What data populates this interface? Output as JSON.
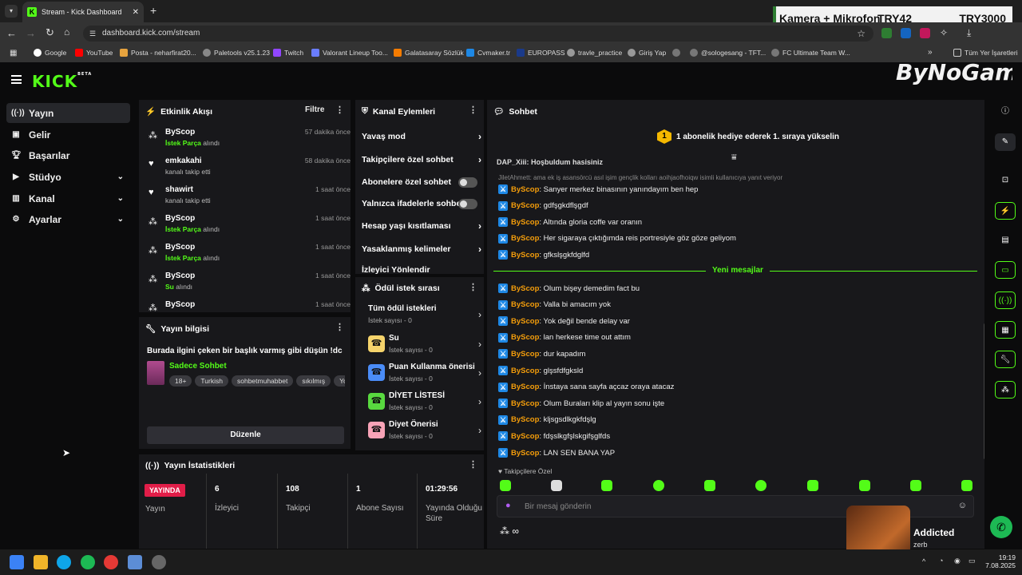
{
  "browser": {
    "tab_title": "Stream - Kick Dashboard",
    "url": "dashboard.kick.com/stream",
    "bookmarks": [
      "Google",
      "YouTube",
      "Posta - neharfirat20...",
      "Paletools v25.1.23",
      "Twitch",
      "Valorant Lineup Too...",
      "Galatasaray Sözlük",
      "Cvmaker.tr",
      "EUROPASS",
      "travle_practice",
      "Giriş Yap",
      "",
      "@sologesang - TFT...",
      "FC Ultimate Team W..."
    ],
    "all_bookmarks": "Tüm Yer İşaretleri"
  },
  "overlay": {
    "top_text": "Kamera + Mikrofon",
    "top_price1": "TRY42",
    "top_price2": "TRY3000",
    "watermark": "ByNoGame",
    "music_title": "Addicted",
    "music_artist": "zerb"
  },
  "kick": {
    "logo": "KICK",
    "logo_beta": "BETA"
  },
  "sidebar": {
    "items": [
      {
        "label": "Yayın",
        "icon": "broadcast-icon"
      },
      {
        "label": "Gelir",
        "icon": "wallet-icon"
      },
      {
        "label": "Başarılar",
        "icon": "trophy-icon"
      },
      {
        "label": "Stüdyo",
        "icon": "video-icon"
      },
      {
        "label": "Kanal",
        "icon": "bars-icon"
      },
      {
        "label": "Ayarlar",
        "icon": "gear-icon"
      }
    ]
  },
  "activity": {
    "title": "Etkinlik Akışı",
    "filter": "Filtre",
    "events": [
      {
        "name": "ByScop",
        "pre": "",
        "hl": "İstek Parça",
        "post": " alındı",
        "time": "57 dakika önce",
        "icon": "reward-icon"
      },
      {
        "name": "emkakahi",
        "pre": "kanalı takip etti",
        "hl": "",
        "post": "",
        "time": "58 dakika önce",
        "icon": "heart-icon"
      },
      {
        "name": "shawirt",
        "pre": "kanalı takip etti",
        "hl": "",
        "post": "",
        "time": "1 saat önce",
        "icon": "heart-icon"
      },
      {
        "name": "ByScop",
        "pre": "",
        "hl": "İstek Parça",
        "post": " alındı",
        "time": "1 saat önce",
        "icon": "reward-icon"
      },
      {
        "name": "ByScop",
        "pre": "",
        "hl": "İstek Parça",
        "post": " alındı",
        "time": "1 saat önce",
        "icon": "reward-icon"
      },
      {
        "name": "ByScop",
        "pre": "",
        "hl": "Su",
        "post": " alındı",
        "time": "1 saat önce",
        "icon": "reward-icon"
      },
      {
        "name": "ByScop",
        "pre": "",
        "hl": "",
        "post": "",
        "time": "1 saat önce",
        "icon": "reward-icon"
      }
    ]
  },
  "channel_actions": {
    "title": "Kanal Eylemleri",
    "items": [
      {
        "label": "Yavaş mod",
        "type": "arrow"
      },
      {
        "label": "Takipçilere özel sohbet",
        "type": "arrow"
      },
      {
        "label": "Abonelere özel sohbet",
        "type": "toggle"
      },
      {
        "label": "Yalnızca ifadelerle sohbet",
        "type": "toggle"
      },
      {
        "label": "Hesap yaşı kısıtlaması",
        "type": "arrow"
      },
      {
        "label": "Yasaklanmış kelimeler",
        "type": "arrow"
      },
      {
        "label": "İzleyici Yönlendir",
        "type": "none"
      }
    ]
  },
  "rewards": {
    "title": "Ödül istek sırası",
    "items": [
      {
        "title": "Tüm ödül istekleri",
        "sub": "İstek sayısı - 0",
        "color": ""
      },
      {
        "title": "Su",
        "sub": "İstek sayısı - 0",
        "color": "#f5d36b"
      },
      {
        "title": "Puan Kullanma önerisi",
        "sub": "İstek sayısı - 0",
        "color": "#4a8cf7"
      },
      {
        "title": "DİYET LİSTESİ",
        "sub": "İstek sayısı - 0",
        "color": "#58d93f"
      },
      {
        "title": "Diyet Önerisi",
        "sub": "İstek sayısı - 0",
        "color": "#f8a3b7"
      }
    ]
  },
  "stream_info": {
    "title": "Yayın bilgisi",
    "stream_title": "Burada ilgini çeken bir başlık varmış gibi düşün !dc",
    "category": "Sadece Sohbet",
    "tags": [
      "18+",
      "Turkish",
      "sohbetmuhabbet",
      "sıkılmış",
      "Yorg"
    ],
    "edit": "Düzenle"
  },
  "stats": {
    "title": "Yayın İstatistikleri",
    "live": "YAYINDA",
    "live_label": "Yayın",
    "items": [
      {
        "value": "6",
        "label": "İzleyici"
      },
      {
        "value": "108",
        "label": "Takipçi"
      },
      {
        "value": "1",
        "label": "Abone Sayısı"
      },
      {
        "value": "01:29:56",
        "label": "Yayında Olduğu Süre"
      }
    ]
  },
  "chat": {
    "title": "Sohbet",
    "pinned_badge": "1",
    "pinned": "1 abonelik hediye ederek 1. sıraya yükselin",
    "cut_top": "DAP_Xiii: Hoşbuldum hasisiniz",
    "reply_line": "JiletAhmett: ama ek iş asansörcü asıl işim gençlik kolları aoihjaofhoiqw isimli kullanıcıya yanıt veriyor",
    "old_messages": [
      {
        "user": "ByScop",
        "text": ": Sanyer merkez binasının yanındayım ben hep"
      },
      {
        "user": "ByScop",
        "text": ": gdfşgkdflşgdf"
      },
      {
        "user": "ByScop",
        "text": ": Altında gloria coffe var oranın"
      },
      {
        "user": "ByScop",
        "text": ": Her sigaraya çıktığımda reis portresiyle göz göze geliyom"
      },
      {
        "user": "ByScop",
        "text": ": gfkslşgkfdglfd"
      }
    ],
    "new_label": "Yeni mesajlar",
    "new_messages": [
      {
        "user": "ByScop",
        "text": ": Olum bişey demedim fact bu"
      },
      {
        "user": "ByScop",
        "text": ": Valla bi amacım yok"
      },
      {
        "user": "ByScop",
        "text": ": Yok değil bende delay var"
      },
      {
        "user": "ByScop",
        "text": ": lan herkese time out attım"
      },
      {
        "user": "ByScop",
        "text": ": dur kapadım"
      },
      {
        "user": "ByScop",
        "text": ": glşsfdfgksld"
      },
      {
        "user": "ByScop",
        "text": ": İnstaya sana sayfa açcaz oraya atacaz"
      },
      {
        "user": "ByScop",
        "text": ": Olum Buraları klip al yayın sonu işte"
      },
      {
        "user": "ByScop",
        "text": ": kljsgsdlkgkfdşlg"
      },
      {
        "user": "ByScop",
        "text": ": fdşslkgfşlskgifşglfds"
      },
      {
        "user": "ByScop",
        "text": ": LAN SEN BANA YAP"
      }
    ],
    "followers_only": "Takipçilere Özel",
    "placeholder": "Bir mesaj gönderin",
    "points": "∞"
  },
  "taskbar": {
    "time": "19:19",
    "date": "7.08.2025"
  }
}
